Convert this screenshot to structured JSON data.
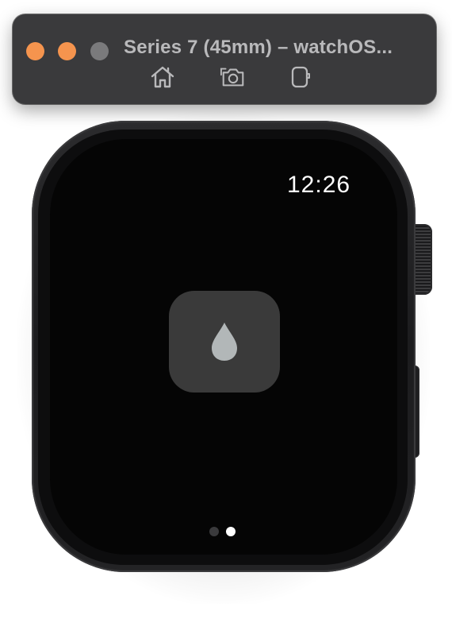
{
  "window": {
    "title": "Series 7 (45mm) – watchOS...",
    "traffic_lights": {
      "close": "#f5944e",
      "minimize": "#f5944e",
      "zoom": "#7a7a7c"
    },
    "toolbar": {
      "home_icon": "home-icon",
      "screenshot_icon": "camera-icon",
      "rotate_icon": "rotate-device-icon"
    }
  },
  "watch": {
    "time": "12:26",
    "app_icon": "water-drop-icon",
    "colors": {
      "screen": "#050505",
      "icon_tile": "#3a3a3a",
      "drop": "#b2b7b8"
    },
    "page_dots": [
      {
        "active": false,
        "color": "#3a3a3c"
      },
      {
        "active": true,
        "color": "#ffffff"
      }
    ]
  }
}
